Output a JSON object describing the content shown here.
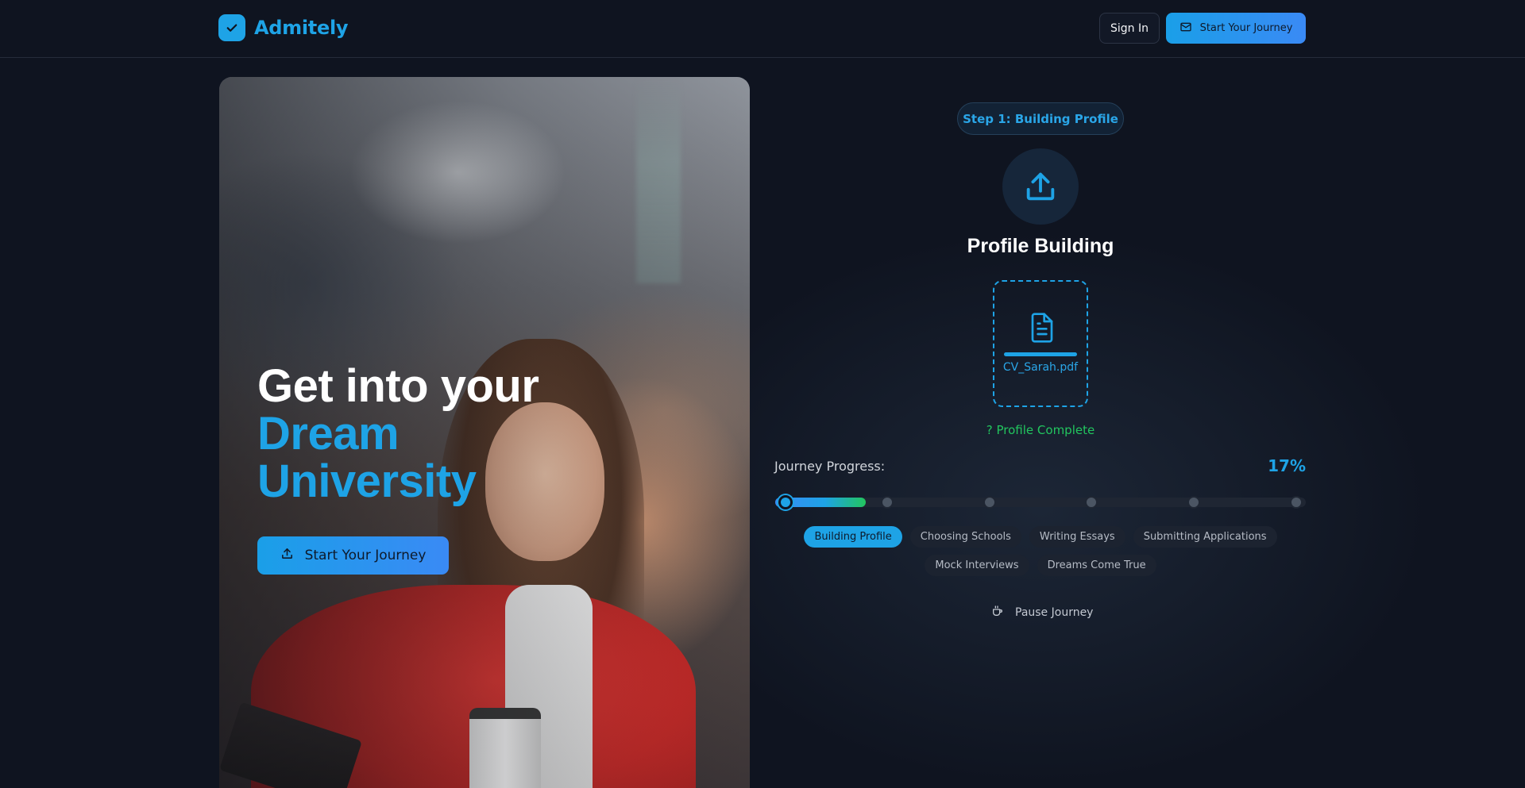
{
  "header": {
    "brand": "Admitely",
    "sign_in_label": "Sign In",
    "cta_label": "Start Your Journey"
  },
  "hero": {
    "headline_line1": "Get into your",
    "headline_line2": "Dream",
    "headline_line3": "University",
    "cta_label": "Start Your Journey"
  },
  "panel": {
    "step_label": "Step 1: Building Profile",
    "title": "Profile Building",
    "file_name": "CV_Sarah.pdf",
    "status": "? Profile Complete",
    "progress_label": "Journey Progress:",
    "progress_text": "17%",
    "progress_fraction": 0.17,
    "stages": [
      {
        "label": "Building Profile",
        "active": true
      },
      {
        "label": "Choosing Schools",
        "active": false
      },
      {
        "label": "Writing Essays",
        "active": false
      },
      {
        "label": "Submitting Applications",
        "active": false
      },
      {
        "label": "Mock Interviews",
        "active": false
      },
      {
        "label": "Dreams Come True",
        "active": false
      }
    ],
    "pause_label": "Pause Journey"
  },
  "colors": {
    "accent": "#1ea3e6",
    "success": "#22c55e",
    "background": "#0f1420"
  },
  "icons": {
    "logo": "check-badge-icon",
    "cta_top": "mail-icon",
    "hero_cta": "upload-icon",
    "upload": "upload-icon",
    "file": "document-icon",
    "pause": "coffee-icon"
  }
}
